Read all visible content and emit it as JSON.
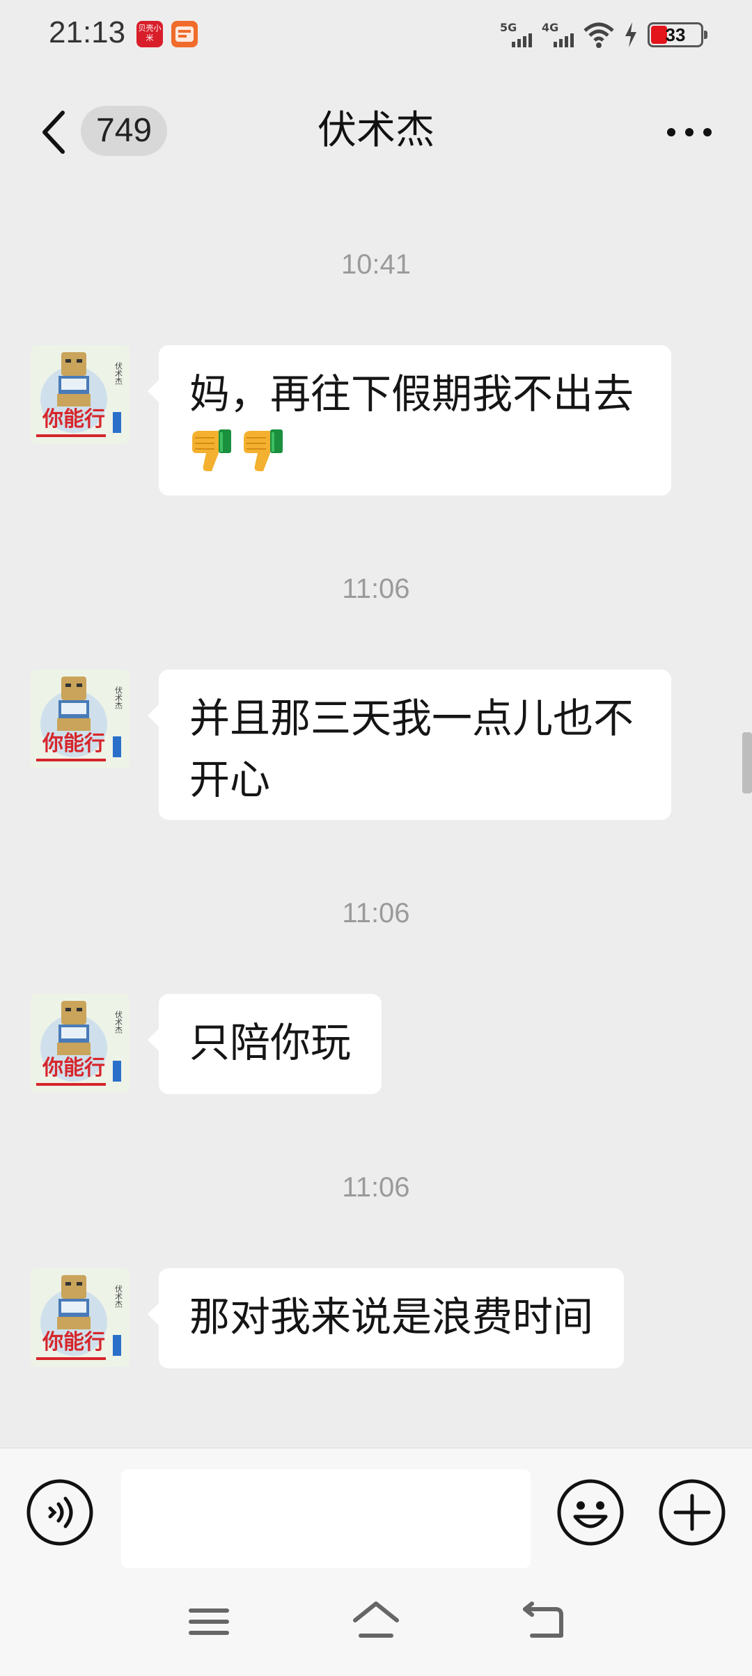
{
  "status_bar": {
    "time": "21:13",
    "app_icon_1_text": "贝壳小米",
    "network_1": "5G",
    "network_2": "4G",
    "battery_level": "33",
    "battery_fraction": 0.33
  },
  "header": {
    "unread_count": "749",
    "title": "伏术杰"
  },
  "messages": [
    {
      "time": "10:41",
      "line1": "妈，再往下假期我不出去",
      "line2": "",
      "emoji": "thumbs-down",
      "emoji_count": 2
    },
    {
      "time": "11:06",
      "line1": "并且那三天我一点儿也不",
      "line2": "开心"
    },
    {
      "time": "11:06",
      "line1": "只陪你玩",
      "line2": ""
    },
    {
      "time": "11:06",
      "line1": "那对我来说是浪费时间",
      "line2": ""
    }
  ],
  "avatar": {
    "caption": "你能行",
    "vertical_text": "伏术杰"
  },
  "input": {
    "value": "",
    "placeholder": ""
  },
  "colors": {
    "background": "#ededed",
    "bubble": "#ffffff",
    "time_text": "#9a9a9a",
    "battery_low": "#e3141b"
  },
  "icons": {
    "back": "chevron-left-icon",
    "more": "more-dots-icon",
    "voice": "voice-icon",
    "emoji": "emoji-icon",
    "plus": "plus-icon",
    "menu": "menu-icon",
    "home": "home-icon",
    "return": "return-icon"
  }
}
